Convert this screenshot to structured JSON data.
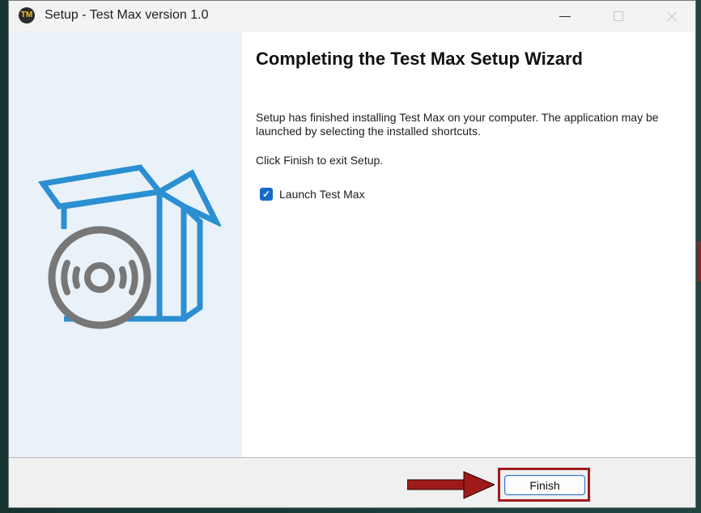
{
  "window": {
    "title": "Setup - Test Max version 1.0",
    "app_icon_text": "TM",
    "controls": {
      "minimize": "minimize",
      "maximize": "maximize",
      "close": "close"
    }
  },
  "wizard": {
    "heading": "Completing the Test Max Setup Wizard",
    "finished_text": "Setup has finished installing Test Max on your computer. The application may be launched by selecting the installed shortcuts.",
    "exit_text": "Click Finish to exit Setup.",
    "launch_checkbox": {
      "checked": true,
      "label": "Launch Test Max"
    }
  },
  "footer": {
    "finish_label": "Finish"
  },
  "icons": {
    "app": "test-max-app-icon",
    "side_graphic": "software-box-cd-icon",
    "checkbox": "check-icon",
    "annotation": "red-arrow-icon"
  },
  "colors": {
    "side_panel": "#e9f2f9",
    "checkbox_blue": "#1668c9",
    "annotation_red": "#9f1b1b",
    "graphic_blue": "#2b8fd2",
    "graphic_gray": "#777777"
  }
}
